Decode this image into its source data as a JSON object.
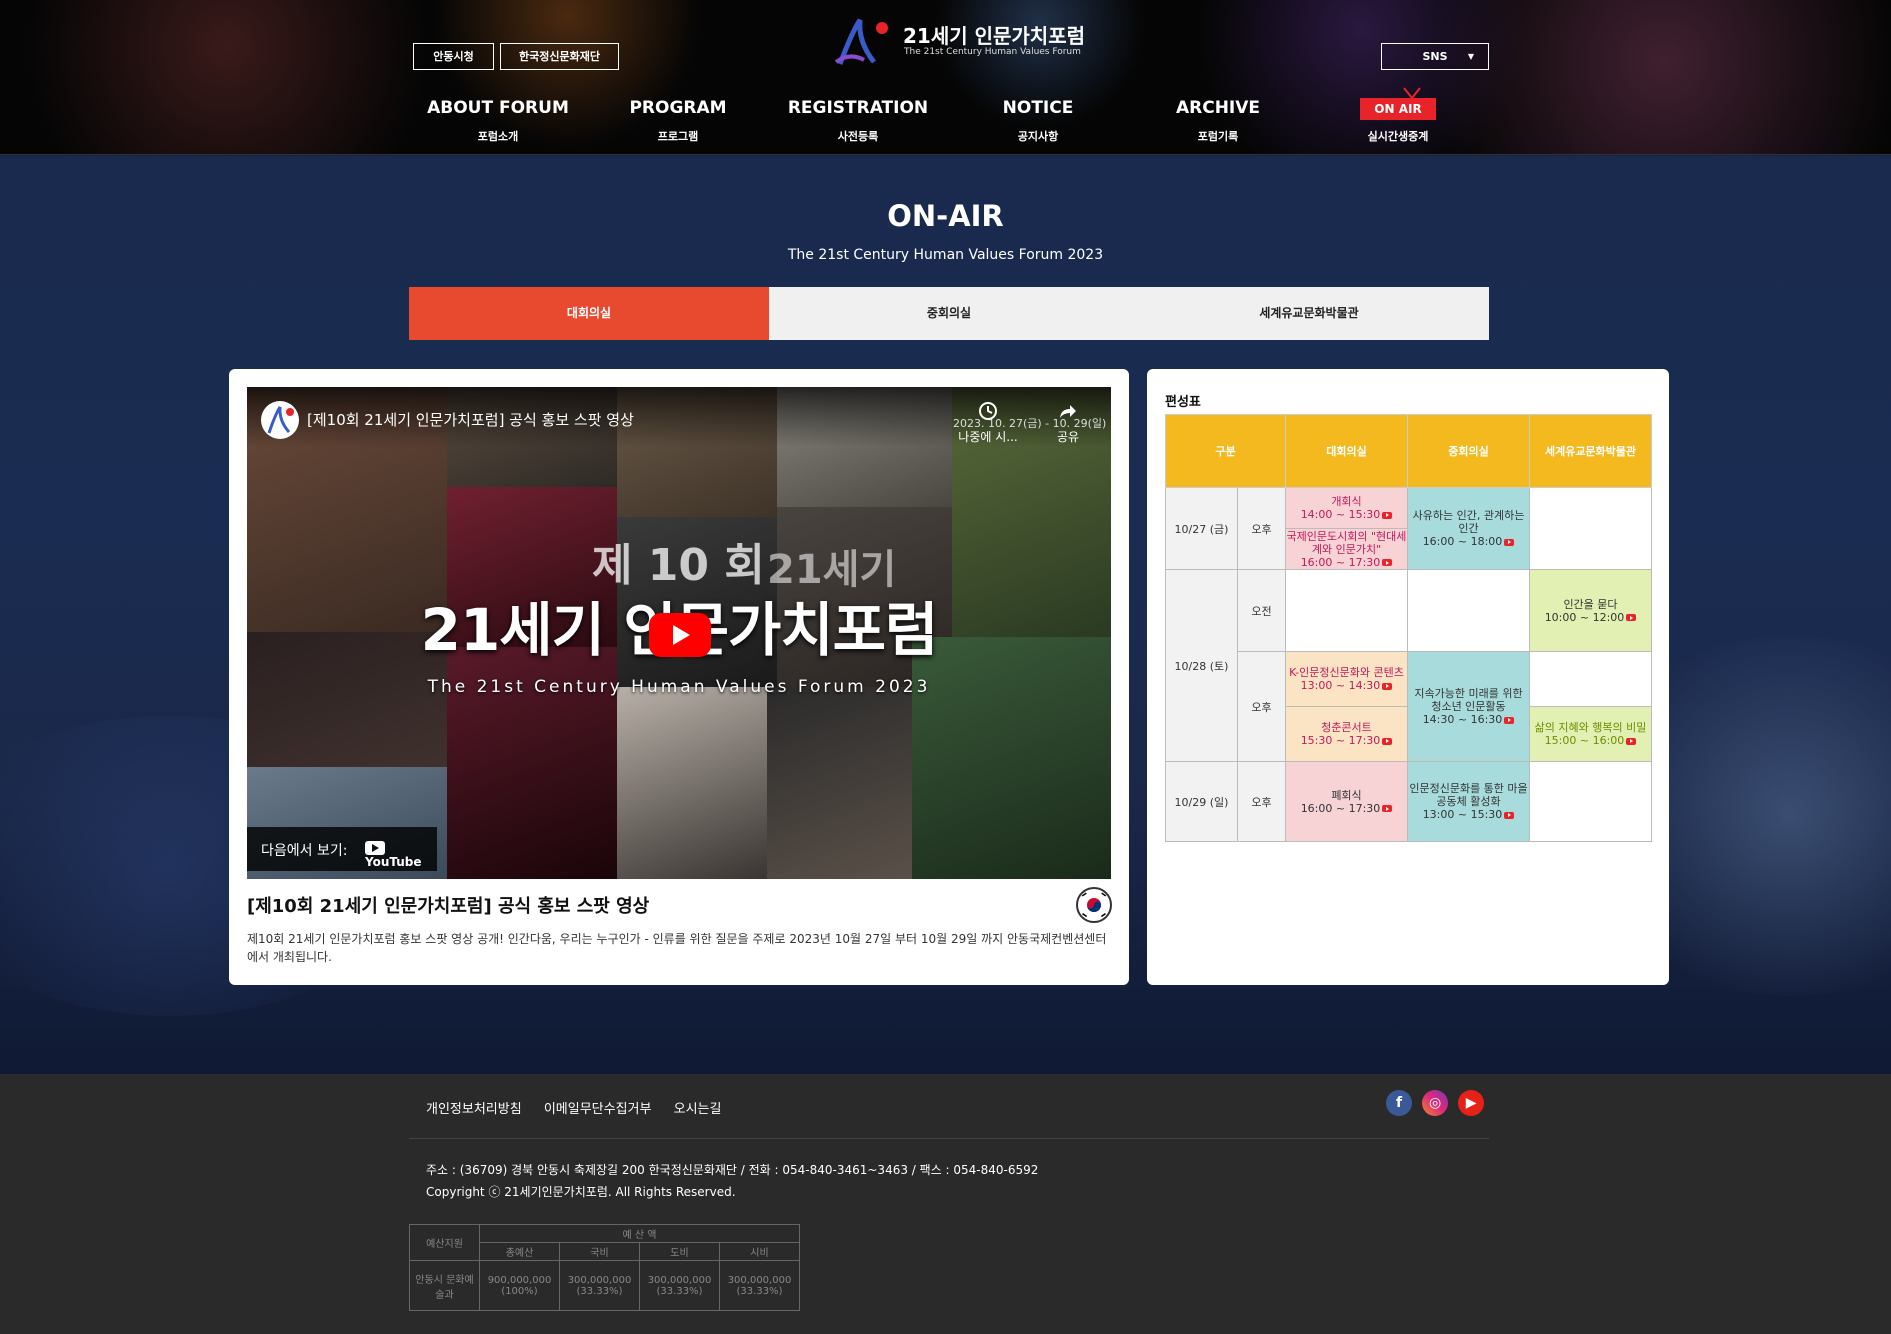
{
  "header": {
    "top_links": [
      "안동시청",
      "한국정신문화재단"
    ],
    "logo_title": "21세기 인문가치포럼",
    "logo_subtitle": "The 21st Century Human Values Forum",
    "sns_label": "SNS",
    "nav": [
      {
        "en": "ABOUT FORUM",
        "ko": "포럼소개"
      },
      {
        "en": "PROGRAM",
        "ko": "프로그램"
      },
      {
        "en": "REGISTRATION",
        "ko": "사전등록"
      },
      {
        "en": "NOTICE",
        "ko": "공지사항"
      },
      {
        "en": "ARCHIVE",
        "ko": "포럼기록"
      },
      {
        "en": "ON AIR",
        "ko": "실시간생중계"
      }
    ]
  },
  "page": {
    "title": "ON-AIR",
    "subtitle": "The 21st Century Human Values Forum 2023"
  },
  "tabs": [
    "대회의실",
    "중회의실",
    "세계유교문화박물관"
  ],
  "video": {
    "overlay_title": "[제10회 21세기 인문가치포럼] 공식 홍보 스팟 영상",
    "date_overlay": "2023. 10. 27(금) - 10. 29(일)",
    "watch_later": "나중에 시...",
    "share": "공유",
    "big_num": "제 10 회",
    "big_num2": "21세기",
    "big_title": "21세기 인문가치포럼",
    "big_sub": "The 21st Century Human Values Forum 2023",
    "watch_on": "다음에서 보기:",
    "youtube": "YouTube",
    "title": "[제10회 21세기 인문가치포럼] 공식 홍보 스팟 영상",
    "description": "제10회 21세기 인문가치포럼 홍보 스팟 영상 공개! 인간다움, 우리는 누구인가 - 인류를 위한 질문을 주제로 2023년 10월 27일 부터 10월 29일 까지 안동국제컨벤션센터에서 개최됩니다."
  },
  "schedule": {
    "heading": "편성표",
    "headers": [
      "구분",
      "대회의실",
      "중회의실",
      "세계유교문화박물관"
    ],
    "days": {
      "d1": "10/27 (금)",
      "d2": "10/28 (토)",
      "d3": "10/29 (일)"
    },
    "periods": {
      "pm": "오후",
      "am": "오전"
    },
    "events": {
      "e1_name": "개회식",
      "e1_time": "14:00 ~ 15:30",
      "e2_name": "국제인문도시회의 \"현대세계와 인문가치\"",
      "e2_time": "16:00 ~ 17:30",
      "e3_name": "사유하는 인간, 관계하는 인간",
      "e3_time": "16:00 ~ 18:00",
      "e4_name": "인간을 묻다",
      "e4_time": "10:00 ~ 12:00",
      "e5_name": "K-인문정신문화와 콘텐츠",
      "e5_time": "13:00 ~ 14:30",
      "e6_name": "청춘콘서트",
      "e6_time": "15:30 ~ 17:30",
      "e7_name": "지속가능한 미래를 위한 청소년 인문활동",
      "e7_time": "14:30 ~ 16:30",
      "e8_name": "삶의 지혜와 행복의 비밀",
      "e8_time": "15:00 ~ 16:00",
      "e9_name": "폐회식",
      "e9_time": "16:00 ~ 17:30",
      "e10_name": "인문정신문화를 통한 마을공동체 활성화",
      "e10_time": "13:00 ~ 15:30"
    }
  },
  "footer": {
    "links": [
      "개인정보처리방침",
      "이메일무단수집거부",
      "오시는길"
    ],
    "address": "주소 : (36709) 경북 안동시 축제장길 200 한국정신문화재단  /  전화 : 054-840-3461~3463 / 팩스 : 054-840-6592",
    "copyright": "Copyright ⓒ 21세기인문가치포럼. All Rights Reserved.",
    "budget": {
      "support_label": "예산지원",
      "budget_label": "예 산 액",
      "cols": [
        "총예산",
        "국비",
        "도비",
        "시비"
      ],
      "org": "안동시 문화예술과",
      "amounts": [
        "900,000,000",
        "300,000,000",
        "300,000,000",
        "300,000,000"
      ],
      "ratios": [
        "(100%)",
        "(33.33%)",
        "(33.33%)",
        "(33.33%)"
      ]
    }
  }
}
